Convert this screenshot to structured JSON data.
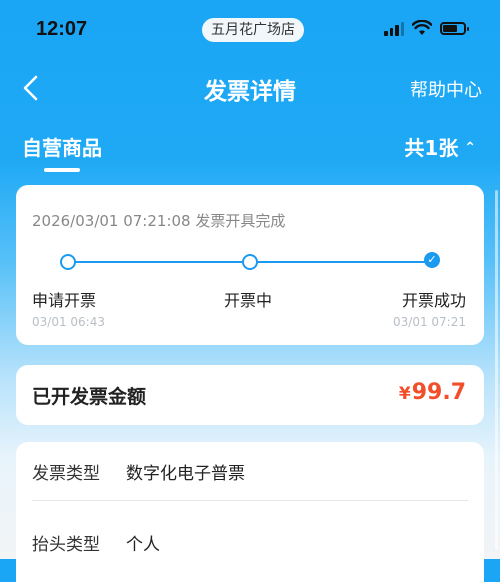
{
  "status_bar": {
    "time": "12:07",
    "store": "五月花广场店"
  },
  "nav": {
    "back_icon": "chevron-left-icon",
    "title": "发票详情",
    "help": "帮助中心"
  },
  "section": {
    "tab": "自营商品",
    "count": "共1张",
    "count_icon": "chevron-up-icon"
  },
  "progress": {
    "status_text": "2026/03/01 07:21:08 发票开具完成",
    "steps": [
      {
        "label": "申请开票",
        "time": "03/01 06:43",
        "state": "done"
      },
      {
        "label": "开票中",
        "time": "",
        "state": "done"
      },
      {
        "label": "开票成功",
        "time": "03/01 07:21",
        "state": "current"
      }
    ],
    "accent": "#1a9af0"
  },
  "amount": {
    "label": "已开发票金额",
    "currency": "¥",
    "value": "99.7",
    "color": "#f24e2a"
  },
  "info": [
    {
      "key": "发票类型",
      "value": "数字化电子普票"
    },
    {
      "key": "抬头类型",
      "value": "个人"
    }
  ]
}
